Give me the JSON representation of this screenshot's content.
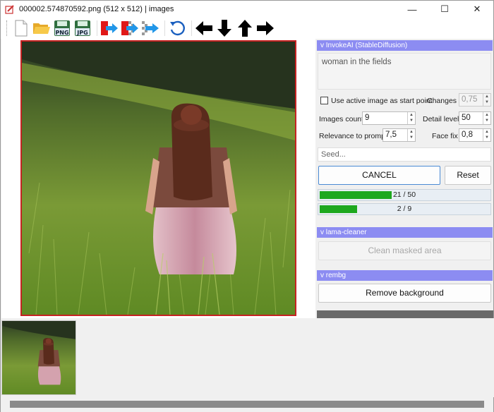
{
  "window": {
    "title": "000002.574870592.png (512 x 512) | images",
    "controls": {
      "minimize": "—",
      "maximize": "☐",
      "close": "✕"
    }
  },
  "toolbar": {
    "icons": [
      "new-document-icon",
      "open-folder-icon",
      "save-png-icon",
      "save-jpg-icon",
      "export-icon",
      "export-transparent-icon",
      "export-blue-icon",
      "undo-icon",
      "arrow-left-icon",
      "arrow-down-icon",
      "arrow-up-icon",
      "arrow-right-icon"
    ],
    "png_label": "PNG",
    "jpg_label": "JPG"
  },
  "invokeai": {
    "header": "v InvokeAI (StableDiffusion)",
    "prompt": "woman in the fields",
    "use_active_label": "Use active image as start point",
    "changes_label": "Changes",
    "changes_value": "0,75",
    "images_count_label": "Images count",
    "images_count_value": "9",
    "detail_level_label": "Detail level",
    "detail_level_value": "50",
    "relevance_label": "Relevance to prompt",
    "relevance_value": "7,5",
    "face_fix_label": "Face fix",
    "face_fix_value": "0,8",
    "seed_placeholder": "Seed...",
    "cancel_label": "CANCEL",
    "reset_label": "Reset",
    "progress1_text": "21 / 50",
    "progress1_fraction": 0.42,
    "progress2_text": "2 / 9",
    "progress2_fraction": 0.22
  },
  "lama": {
    "header": "v lama-cleaner",
    "clean_label": "Clean masked area"
  },
  "rembg": {
    "header": "v rembg",
    "remove_label": "Remove background"
  },
  "colors": {
    "panel_header": "#8c8cf2",
    "progress_fill": "#1ea81e",
    "image_border": "#c52222"
  }
}
